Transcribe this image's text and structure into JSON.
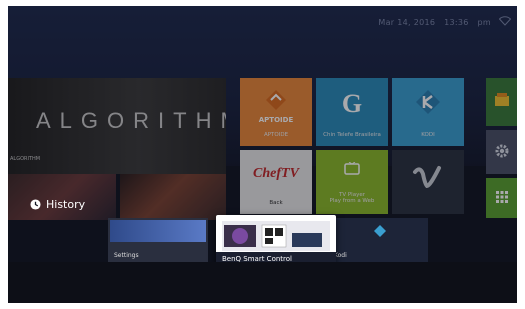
{
  "status": {
    "date": "Mar 14, 2016",
    "time": "13:36",
    "ampm": "pm"
  },
  "banner": {
    "title": "ALGORITHM",
    "subtitle": "ALGORITHM"
  },
  "tiles": {
    "aptoide": {
      "label": "APTOIDE",
      "logo_text": "APTOIDE",
      "color": "#e8873a"
    },
    "tsmart": {
      "label": "Chin Telefe Brasileira",
      "color": "#2a8ab8"
    },
    "kodi": {
      "label": "KODI",
      "color": "#3a9fd0"
    },
    "cheftv": {
      "label": "Back",
      "logo_text": "ChefTV",
      "color": "#e6e6e6"
    },
    "tvplayer": {
      "label": "TV Player\nPlay from a Web",
      "color": "#8ab82a"
    },
    "vimeo": {
      "label": "Vimeo",
      "color": "#2a3240"
    },
    "settings_side": {
      "color": "#3a7a3a"
    },
    "gear_side": {
      "color": "#4a5166"
    },
    "grid_side": {
      "color": "#5aa030"
    }
  },
  "history": {
    "label": "History"
  },
  "recent": {
    "settings": {
      "label": "Settings"
    },
    "benq": {
      "label": "BenQ Smart Control"
    },
    "kodi": {
      "label": "Kodi"
    }
  }
}
